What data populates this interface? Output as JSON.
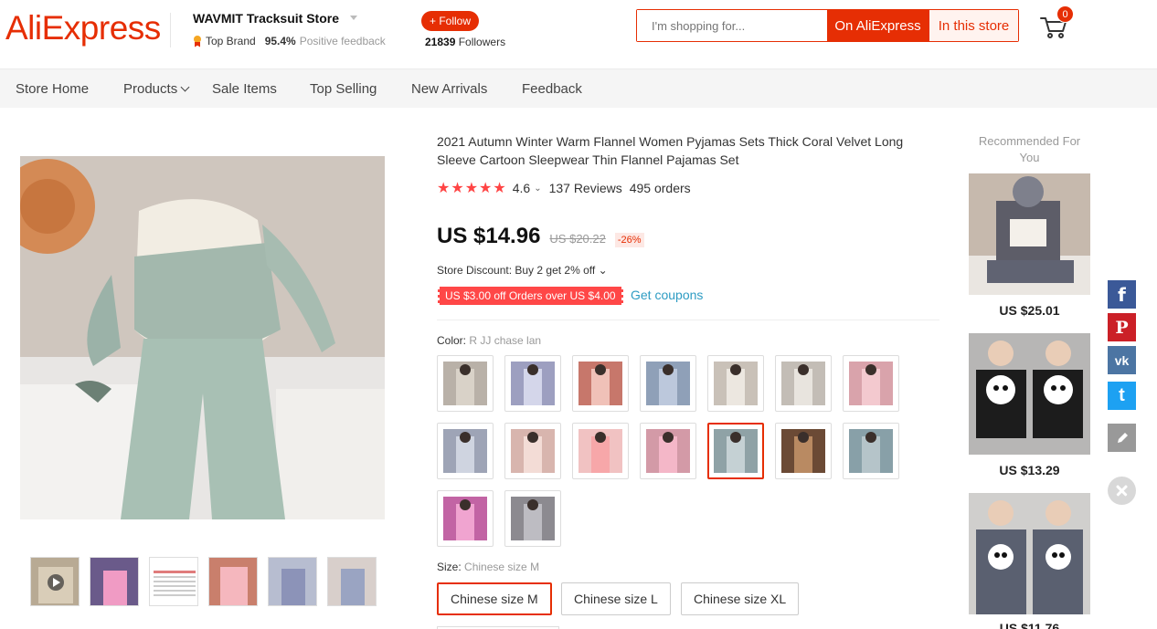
{
  "header": {
    "logo": "AliExpress",
    "store_name": "WAVMIT Tracksuit Store",
    "top_brand": "Top Brand",
    "positive_pct": "95.4%",
    "positive_label": "Positive feedback",
    "follow_label": "+ Follow",
    "followers_count": "21839",
    "followers_label": "Followers",
    "search_placeholder": "I'm shopping for...",
    "search_on_ali": "On AliExpress",
    "search_in_store": "In this store",
    "cart_count": "0"
  },
  "nav": {
    "items": [
      "Store Home",
      "Products",
      "Sale Items",
      "Top Selling",
      "New Arrivals",
      "Feedback"
    ]
  },
  "product": {
    "title": "2021 Autumn Winter Warm Flannel Women Pyjamas Sets Thick Coral Velvet Long Sleeve Cartoon Sleepwear Thin Flannel Pajamas Set",
    "stars": "★★★★★",
    "rating": "4.6",
    "reviews": "137 Reviews",
    "orders": "495 orders",
    "price": "US $14.96",
    "original_price": "US $20.22",
    "discount_pct": "-26%",
    "store_discount": "Store Discount: Buy 2 get 2% off",
    "coupon": "US $3.00 off Orders over US $4.00",
    "get_coupons": "Get coupons",
    "color_label": "Color:",
    "color_value": "R JJ chase lan",
    "size_label": "Size:",
    "size_value": "Chinese size M",
    "sizes": [
      "Chinese size M",
      "Chinese size L",
      "Chinese size XL"
    ],
    "swatch_count": 16,
    "selected_swatch_index": 11
  },
  "recommended": {
    "title": "Recommended For You",
    "items": [
      {
        "price": "US $25.01"
      },
      {
        "price": "US $13.29"
      },
      {
        "price": "US $11.76"
      }
    ]
  },
  "share": {
    "facebook": "f",
    "pinterest": "P",
    "vk": "vk",
    "twitter": "t"
  },
  "colors": {
    "accent": "#e62e04",
    "link": "#2e9cc3",
    "star": "#ff4444",
    "facebook": "#3b5998",
    "pinterest": "#cb2027",
    "vk": "#4c75a3",
    "twitter": "#1da1f2",
    "edit": "#999999"
  }
}
